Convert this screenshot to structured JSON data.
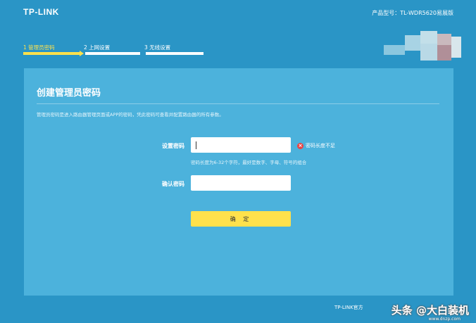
{
  "header": {
    "logo": "TP-LINK",
    "model_label": "产品型号：TL-WDR5620易展版"
  },
  "steps": [
    {
      "label": "1 管理员密码",
      "active": true
    },
    {
      "label": "2 上网设置",
      "active": false
    },
    {
      "label": "3 无线设置",
      "active": false
    }
  ],
  "panel": {
    "title": "创建管理员密码",
    "description": "管理员密码是进入路由器管理页面或APP的密码，凭此密码可查看并配置路由器的所有参数。",
    "password": {
      "label": "设置密码",
      "value": "",
      "error": "密码长度不足",
      "hint": "密码长度为6-32个字符，最好是数字、字母、符号的组合"
    },
    "confirm": {
      "label": "确认密码",
      "value": ""
    },
    "ok_label": "确 定"
  },
  "footer": {
    "text": "TP-LINK官方"
  },
  "watermark": {
    "text": "头条 @大白装机",
    "sub": "www.dnzp.com"
  },
  "colors": {
    "background": "#2a95c6",
    "panel": "#4cb2dc",
    "accent": "#ffe14c",
    "error": "#e84545"
  }
}
